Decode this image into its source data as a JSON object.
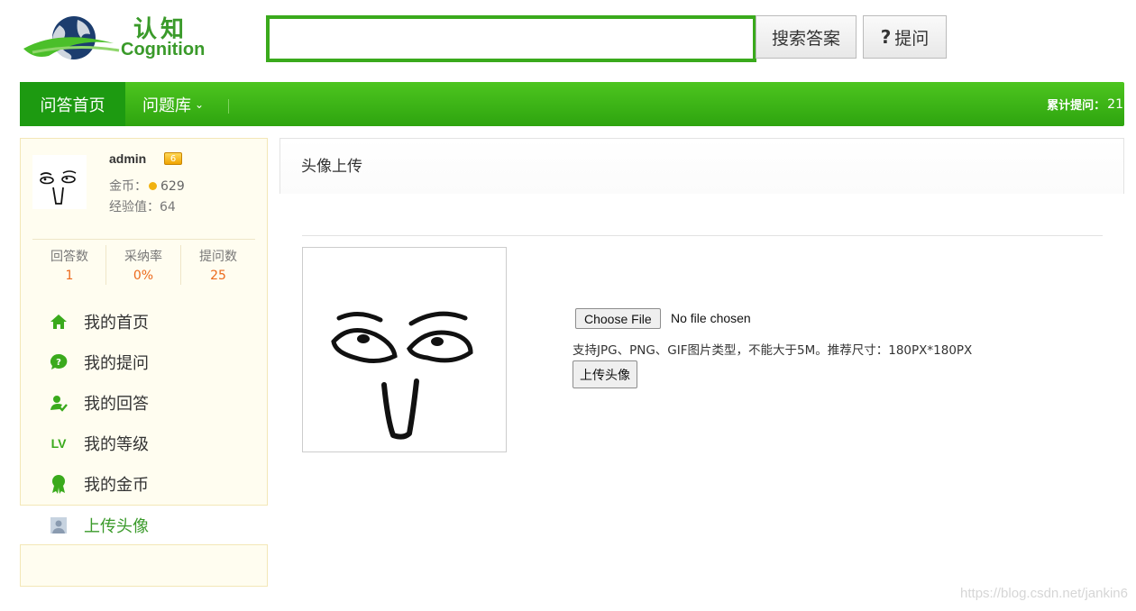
{
  "header": {
    "logo_cn": "认知",
    "logo_en": "Cognition",
    "search_value": "",
    "search_button": "搜索答案",
    "ask_button": "提问",
    "ask_icon": "?"
  },
  "nav": {
    "home": "问答首页",
    "library": "问题库",
    "library_chevron": "⌄",
    "total_label": "累计提问：",
    "total_value": "21"
  },
  "user": {
    "name": "admin",
    "level": "6",
    "coins_label": "金币：",
    "coins": "629",
    "exp_label": "经验值：",
    "exp": "64",
    "stats": [
      {
        "label": "回答数",
        "value": "1"
      },
      {
        "label": "采纳率",
        "value": "0%"
      },
      {
        "label": "提问数",
        "value": "25"
      }
    ]
  },
  "menu": [
    {
      "label": "我的首页",
      "icon": "home-icon"
    },
    {
      "label": "我的提问",
      "icon": "question-bubble-icon"
    },
    {
      "label": "我的回答",
      "icon": "user-check-icon"
    },
    {
      "label": "我的等级",
      "icon": "level-icon",
      "icon_text": "LV"
    },
    {
      "label": "我的金币",
      "icon": "medal-icon"
    },
    {
      "label": "上传头像",
      "icon": "avatar-upload-icon",
      "active": true
    }
  ],
  "main": {
    "title": "头像上传",
    "file_button": "Choose File",
    "file_status": "No file chosen",
    "hint": "支持JPG、PNG、GIF图片类型，不能大于5M。推荐尺寸：180PX*180PX",
    "upload_button": "上传头像"
  },
  "watermark": "https://blog.csdn.net/jankin6",
  "colors": {
    "brand_green": "#3aaa1c",
    "nav_active": "#1d9a11",
    "stat_orange": "#ec6a1c",
    "sidebar_bg": "#fffdf0"
  }
}
